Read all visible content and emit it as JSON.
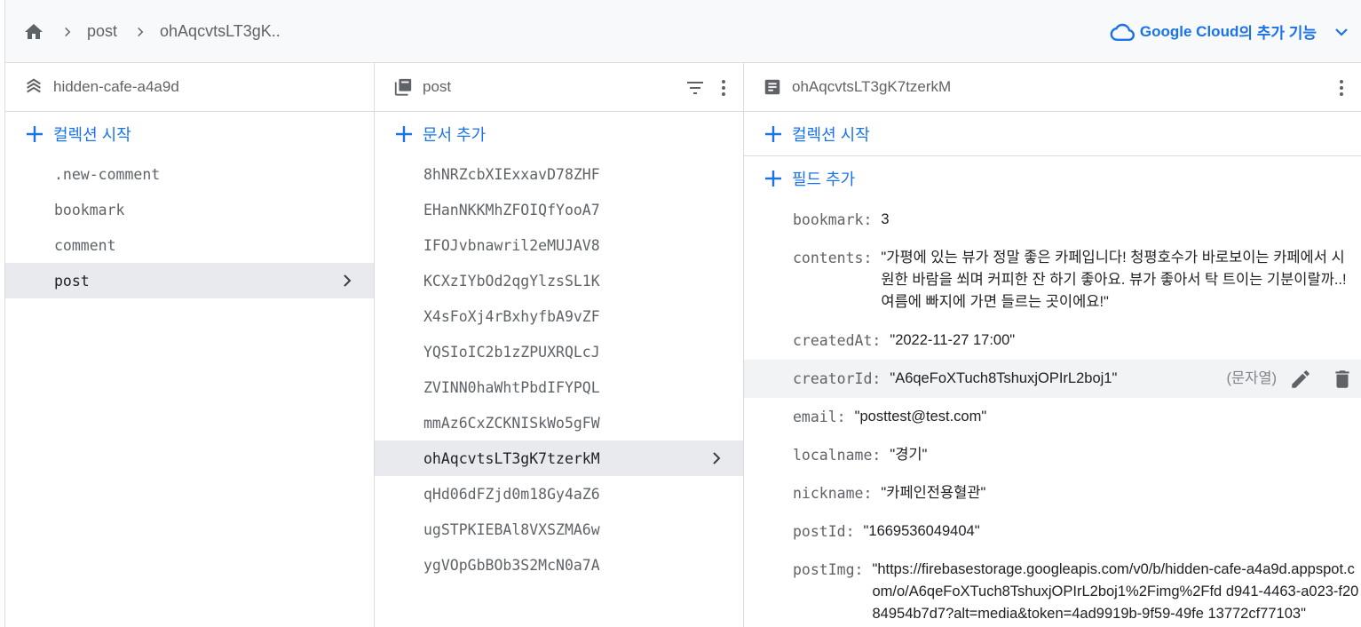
{
  "breadcrumb": {
    "home_icon": "home-icon",
    "items": [
      "post",
      "ohAqcvtsLT3gK.."
    ]
  },
  "google_cloud": {
    "brand": "Google Cloud",
    "suffix": "의 추가 기능",
    "color": "#1a73e8"
  },
  "columns": {
    "root": {
      "title": "hidden-cafe-a4a9d",
      "add_label": "컬렉션 시작",
      "items": [
        ".new-comment",
        "bookmark",
        "comment",
        "post"
      ],
      "selected": "post"
    },
    "collection": {
      "title": "post",
      "add_label": "문서 추가",
      "items": [
        "8hNRZcbXIExxavD78ZHF",
        "EHanNKKMhZFOIQfYooA7",
        "IFOJvbnawril2eMUJAV8",
        "KCXzIYbOd2qgYlzsSL1K",
        "X4sFoXj4rBxhyfbA9vZF",
        "YQSIoIC2b1zZPUXRQLcJ",
        "ZVINN0haWhtPbdIFYPQL",
        "mmAz6CxZCKNISkWo5gFW",
        "ohAqcvtsLT3gK7tzerkM",
        "qHd06dFZjd0m18Gy4aZ6",
        "ugSTPKIEBAl8VXSZMA6w",
        "ygVOpGbBOb3S2McN0a7A"
      ],
      "selected": "ohAqcvtsLT3gK7tzerkM"
    },
    "document": {
      "title": "ohAqcvtsLT3gK7tzerkM",
      "add_collection_label": "컬렉션 시작",
      "add_field_label": "필드 추가",
      "fields": {
        "bookmark": {
          "key": "bookmark:",
          "value": "3"
        },
        "contents": {
          "key": "contents:",
          "value": "\"가평에 있는 뷰가 정말 좋은 카페입니다! 청평호수가 바로보이는 카페에서 시원한 바람을 쐬며 커피한 잔 하기 좋아요. 뷰가 좋아서 탁 트이는 기분이랄까..! 여름에 빠지에 가면 들르는 곳이에요!\""
        },
        "createdAt": {
          "key": "createdAt:",
          "value": "\"2022-11-27 17:00\""
        },
        "creatorId": {
          "key": "creatorId:",
          "value": "\"A6qeFoXTuch8TshuxjOPIrL2boj1\"",
          "type": "(문자열)"
        },
        "email": {
          "key": "email:",
          "value": "\"posttest@test.com\""
        },
        "localname": {
          "key": "localname:",
          "value": "\"경기\""
        },
        "nickname": {
          "key": "nickname:",
          "value": "\"카페인전용혈관\""
        },
        "postId": {
          "key": "postId:",
          "value": "\"1669536049404\""
        },
        "postImg": {
          "key": "postImg:",
          "value": "\"https://firebasestorage.googleapis.com/v0/b/hidden-cafe-a4a9d.appspot.com/o/A6qeFoXTuch8TshuxjOPIrL2boj1%2Fimg%2Ffd d941-4463-a023-f2084954b7d7?alt=media&token=4ad9919b-9f59-49fe 13772cf77103\""
        }
      }
    }
  }
}
